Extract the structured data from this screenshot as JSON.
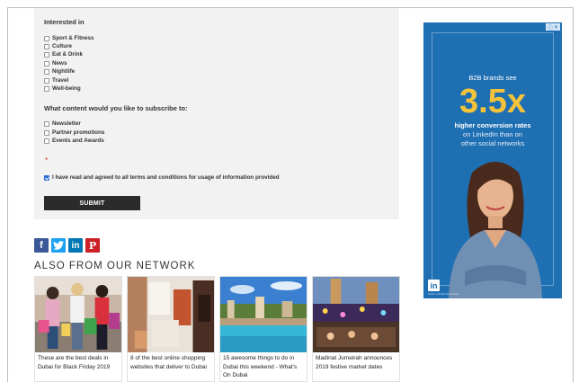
{
  "form": {
    "interested_title": "Interested in",
    "interests": [
      {
        "label": "Sport & Fitness",
        "checked": false
      },
      {
        "label": "Culture",
        "checked": false
      },
      {
        "label": "Eat & Drink",
        "checked": false
      },
      {
        "label": "News",
        "checked": false
      },
      {
        "label": "Nightlife",
        "checked": false
      },
      {
        "label": "Travel",
        "checked": false
      },
      {
        "label": "Well-being",
        "checked": false
      }
    ],
    "subscribe_title": "What content would you like to subscribe to:",
    "subscriptions": [
      {
        "label": "Newsletter",
        "checked": false
      },
      {
        "label": "Partner promotions",
        "checked": false
      },
      {
        "label": "Events and Awards",
        "checked": false
      }
    ],
    "required_marker": "*",
    "terms": {
      "label": "I have read and agreed to all terms and conditions for usage of information provided",
      "checked": true
    },
    "submit_label": "SUBMIT"
  },
  "social": {
    "facebook": {
      "glyph": "f",
      "color": "#3b5998"
    },
    "twitter": {
      "color": "#1da1f2"
    },
    "linkedin": {
      "glyph": "in",
      "color": "#0077b5"
    },
    "pinterest": {
      "glyph": "P",
      "color": "#cb2027"
    }
  },
  "network": {
    "title": "ALSO FROM OUR NETWORK",
    "cards": [
      {
        "caption": "These are the best deals in Dubai for Black Friday 2019"
      },
      {
        "caption": "8 of the best online shopping websites that deliver to Dubai"
      },
      {
        "caption": "15 awesome things to do in Dubai this weekend - What's On Dubai"
      },
      {
        "caption": "Madinat Jumeirah announces 2019 festive market dates"
      }
    ]
  },
  "ad": {
    "lead": "B2B brands see",
    "big": "3.5x",
    "strong": "higher conversion rates",
    "sub1": "on LinkedIn than on",
    "sub2": "other social networks",
    "logo": "in",
    "fine_print": "Source: LinkedIn Internal Data",
    "colors": {
      "background": "#1f6fb3",
      "highlight": "#f4c33a"
    }
  }
}
